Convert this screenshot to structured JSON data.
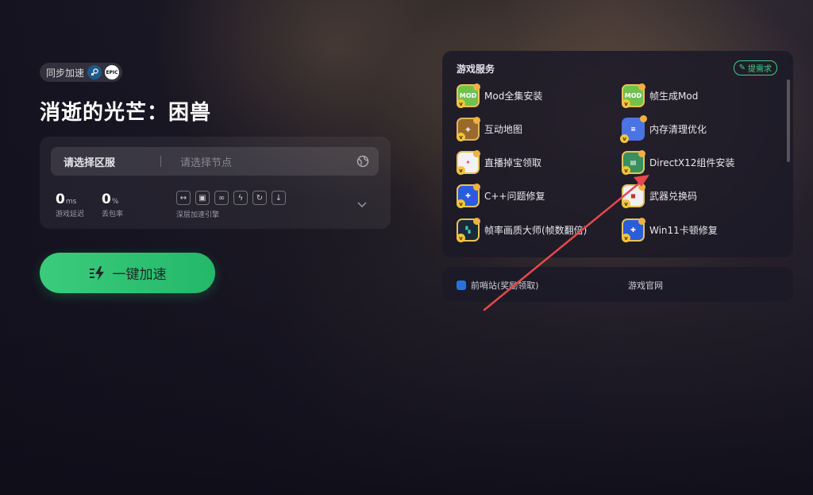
{
  "header": {
    "sync_label": "同步加速",
    "platform_icons": [
      "steam-logo",
      "epic-logo"
    ],
    "epic_text": "EPIC",
    "game_title": "消逝的光芒：困兽"
  },
  "server": {
    "region_label": "请选择区服",
    "node_placeholder": "请选择节点",
    "latency_value": "0",
    "latency_unit": "ms",
    "latency_label": "游戏延迟",
    "loss_value": "0",
    "loss_unit": "%",
    "loss_label": "丢包率",
    "engine_label": "深层加速引擎"
  },
  "accelerate_button": "一键加速",
  "services": {
    "title": "游戏服务",
    "request_label": "提需求",
    "items": [
      {
        "label": "Mod全集安装",
        "icon": "mod-icon",
        "icon_text": "MOD"
      },
      {
        "label": "帧生成Mod",
        "icon": "mod-icon",
        "icon_text": "MOD"
      },
      {
        "label": "互动地图",
        "icon": "map-icon",
        "icon_text": ""
      },
      {
        "label": "内存清理优化",
        "icon": "memory-icon",
        "icon_text": ""
      },
      {
        "label": "直播掉宝领取",
        "icon": "live-icon",
        "icon_text": ""
      },
      {
        "label": "DirectX12组件安装",
        "icon": "directx-icon",
        "icon_text": ""
      },
      {
        "label": "C++问题修复",
        "icon": "wrench-icon",
        "icon_text": ""
      },
      {
        "label": "武器兑换码",
        "icon": "code-icon",
        "icon_text": ""
      },
      {
        "label": "帧率画质大师(帧数翻倍)",
        "icon": "fps-icon",
        "icon_text": ""
      },
      {
        "label": "Win11卡顿修复",
        "icon": "wrench-icon",
        "icon_text": ""
      }
    ]
  },
  "links": {
    "outpost": "前哨站(奖励领取)",
    "official": "游戏官网"
  },
  "colors": {
    "accent_green": "#3ccb7c",
    "annotation_red": "#e5484d"
  }
}
